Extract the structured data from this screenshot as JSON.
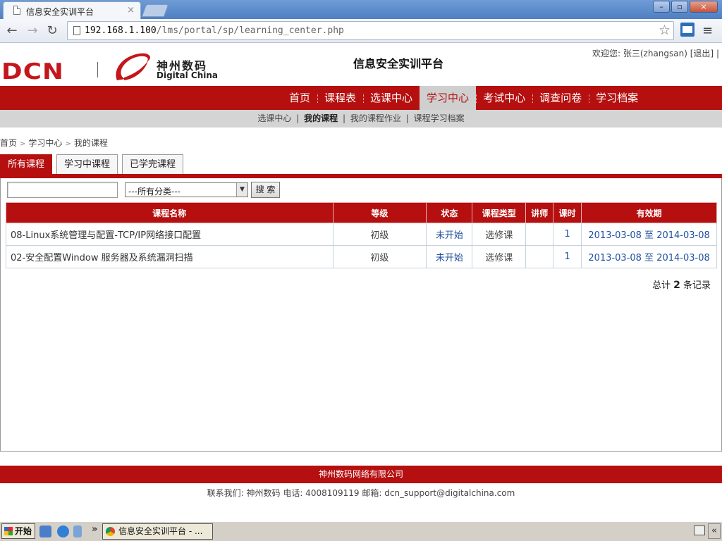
{
  "browser": {
    "tab_title": "信息安全实训平台",
    "tab_close": "×",
    "url_host": "192.168.1.100",
    "url_path": "/lms/portal/sp/learning_center.php",
    "window_buttons": [
      "–",
      "▫",
      "×"
    ]
  },
  "header": {
    "logo_text": "DCN",
    "logo_cn": "神州数码",
    "logo_en": "Digital China",
    "site_title": "信息安全实训平台",
    "welcome_prefix": "欢迎您:",
    "user": "张三(zhangsan)",
    "logout": "[退出]",
    "trailing_sep": "|"
  },
  "main_nav": [
    "首页",
    "课程表",
    "选课中心",
    "学习中心",
    "考试中心",
    "调查问卷",
    "学习档案"
  ],
  "sub_nav": {
    "items": [
      "选课中心",
      "我的课程",
      "我的课程作业",
      "课程学习档案"
    ],
    "separator": "|"
  },
  "breadcrumb": {
    "items": [
      "首页",
      "学习中心",
      "我的课程"
    ],
    "separator": ">"
  },
  "course_tabs": [
    "所有课程",
    "学习中课程",
    "已学完课程"
  ],
  "filter": {
    "search_value": "",
    "category_selected": "---所有分类---",
    "search_button": "搜 索"
  },
  "table": {
    "columns": [
      "课程名称",
      "等级",
      "状态",
      "课程类型",
      "讲师",
      "课时",
      "有效期"
    ],
    "rows": [
      {
        "name": "08-Linux系统管理与配置-TCP/IP网络接口配置",
        "level": "初级",
        "status": "未开始",
        "type": "选修课",
        "teacher": "",
        "hours": "1",
        "validity": "2013-03-08 至 2014-03-08"
      },
      {
        "name": "02-安全配置Window 服务器及系统漏洞扫描",
        "level": "初级",
        "status": "未开始",
        "type": "选修课",
        "teacher": "",
        "hours": "1",
        "validity": "2013-03-08 至 2014-03-08"
      }
    ]
  },
  "total": {
    "prefix": "总计",
    "count": "2",
    "suffix": "条记录"
  },
  "footer": {
    "company": "神州数码网络有限公司",
    "contact": "联系我们: 神州数码  电话: 4008109119  邮箱: dcn_support@digitalchina.com"
  },
  "taskbar": {
    "start": "开始",
    "task_item": "信息安全实训平台 - ...",
    "overflow": "»",
    "tray_arrow": "«"
  },
  "colors": {
    "brand_red": "#b50f0f",
    "link_blue": "#1d4f9e"
  }
}
